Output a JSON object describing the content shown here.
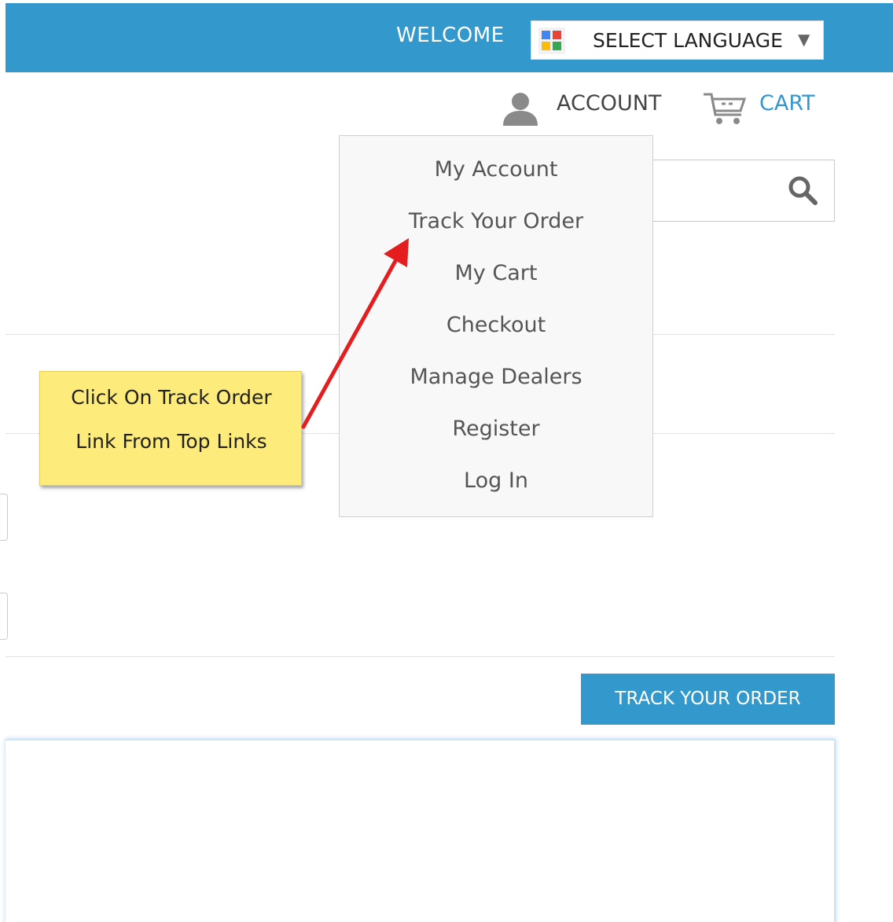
{
  "header": {
    "welcome": "WELCOME",
    "language_select": "SELECT LANGUAGE",
    "caret": "▼"
  },
  "top_links": {
    "account": "ACCOUNT",
    "cart": "CART"
  },
  "account_menu": {
    "items": [
      "My Account",
      "Track Your Order",
      "My Cart",
      "Checkout",
      "Manage Dealers",
      "Register",
      "Log In"
    ]
  },
  "callout": {
    "line1": "Click On Track Order",
    "line2": "Link From Top Links"
  },
  "track_button": "TRACK YOUR ORDER",
  "colors": {
    "brand_blue": "#3399cc",
    "callout_yellow": "#fdeb7c",
    "arrow_red": "#e41e1e"
  },
  "icons": {
    "search": "search-icon",
    "account": "person-icon",
    "cart": "cart-icon",
    "language": "google-logo-icon"
  }
}
